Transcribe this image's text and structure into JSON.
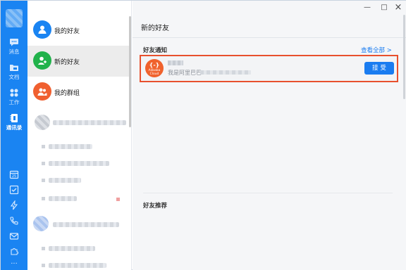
{
  "window": {
    "minimize": "—",
    "maximize": "□",
    "close": "×"
  },
  "rail": {
    "items": [
      {
        "label": "消息",
        "icon": "chat-icon"
      },
      {
        "label": "文档",
        "icon": "folder-icon"
      },
      {
        "label": "工作",
        "icon": "apps-icon"
      },
      {
        "label": "通讯录",
        "icon": "contacts-icon",
        "active": true
      }
    ],
    "tools": [
      "calendar-icon",
      "todo-icon",
      "lightning-icon",
      "phone-icon",
      "mail-icon",
      "puzzle-icon",
      "more-icon"
    ],
    "more_label": "···",
    "accent": "#1a84f2"
  },
  "contacts": {
    "items": [
      {
        "label": "我的好友",
        "color": "#1a84f2",
        "icon": "person-icon"
      },
      {
        "label": "新的好友",
        "color": "#21b24b",
        "icon": "add-person-icon",
        "selected": true
      },
      {
        "label": "我的群组",
        "color": "#f06030",
        "icon": "group-icon"
      }
    ]
  },
  "main": {
    "title": "新的好友",
    "notifications": {
      "label": "好友通知",
      "view_all": "查看全部 >",
      "item": {
        "avatar_symbol": "{-}",
        "avatar_brand": "Alibaba Cloud",
        "message": "我是阿里巴巴",
        "accept": "接 受"
      }
    },
    "recommend_label": "好友推荐",
    "highlight_color": "#e8502e"
  }
}
